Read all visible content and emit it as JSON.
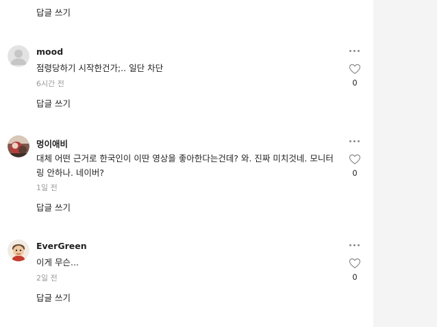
{
  "top_reply_label": "답글 쓰기",
  "comments": [
    {
      "author": "mood",
      "avatar": "default-user-icon",
      "text": "점령당하기 시작한건가;.. 일단 차단",
      "time": "6시간 전",
      "likes": "0",
      "reply_label": "답글 쓰기"
    },
    {
      "author": "멍이애비",
      "avatar": "user-photo",
      "text": "대체 어떤 근거로 한국인이 이딴 영상을 좋아한다는건데? 와. 진짜 미치것네. 모니터링 안하나. 네이버?",
      "time": "1일 전",
      "likes": "0",
      "reply_label": "답글 쓰기"
    },
    {
      "author": "EverGreen",
      "avatar": "character-avatar",
      "text": "이게 무슨...",
      "time": "2일 전",
      "likes": "0",
      "reply_label": "답글 쓰기"
    }
  ],
  "icons": {
    "more": "more-options-icon",
    "like": "heart-icon"
  },
  "colors": {
    "text": "#222222",
    "muted": "#999999",
    "icon": "#8a8a8a",
    "side_panel": "#f4f4f4"
  }
}
